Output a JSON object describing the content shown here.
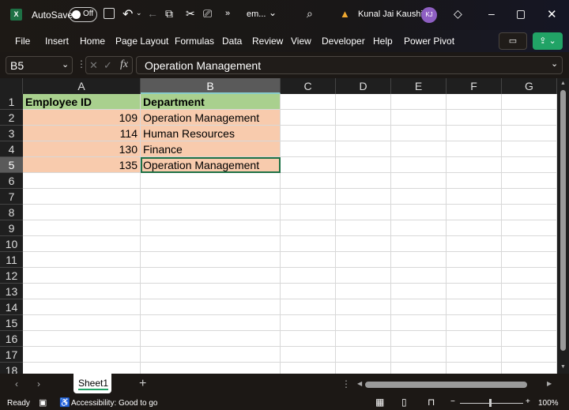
{
  "titlebar": {
    "app_icon": "excel-icon",
    "autosave_label": "AutoSave",
    "autosave_state": "Off",
    "filename": "em...",
    "user_name": "Kunal Jai Kaushik",
    "user_initials": "KJ",
    "warning_icon": "warning-icon"
  },
  "ribbon": {
    "tabs": [
      "File",
      "Insert",
      "Home",
      "Page Layout",
      "Formulas",
      "Data",
      "Review",
      "View",
      "Developer",
      "Help",
      "Power Pivot"
    ]
  },
  "formula_bar": {
    "name_box": "B5",
    "fx": "fx",
    "value": "Operation Management"
  },
  "columns": [
    "A",
    "B",
    "C",
    "D",
    "E",
    "F",
    "G"
  ],
  "rows": [
    "1",
    "2",
    "3",
    "4",
    "5",
    "6",
    "7",
    "8",
    "9",
    "10",
    "11",
    "12",
    "13",
    "14",
    "15",
    "16",
    "17",
    "18"
  ],
  "table": {
    "headers": [
      "Employee ID",
      "Department"
    ],
    "rows": [
      [
        "109",
        "Operation Management"
      ],
      [
        "114",
        "Human Resources"
      ],
      [
        "130",
        "Finance"
      ],
      [
        "135",
        "Operation Management"
      ]
    ]
  },
  "colors": {
    "header_fill": "#a9d08e",
    "data_fill": "#f8cbad",
    "accent": "#21a366"
  },
  "sheets": {
    "tabs": [
      "Sheet1"
    ],
    "active": "Sheet1"
  },
  "status": {
    "ready": "Ready",
    "accessibility": "Accessibility: Good to go",
    "zoom": "100%"
  }
}
